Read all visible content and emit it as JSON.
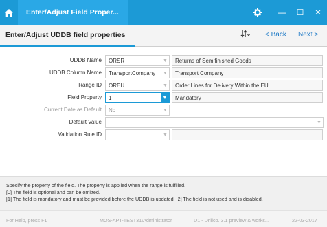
{
  "window": {
    "title": "Enter/Adjust Field Proper...",
    "home_icon": "home-icon",
    "settings_icon": "gear-icon",
    "controls": {
      "minimize": "—",
      "maximize": "☐",
      "close": "✕"
    }
  },
  "header": {
    "title": "Enter/Adjust UDDB field properties",
    "sort_icon": "sort-icon",
    "back_label": "< Back",
    "next_label": "Next >"
  },
  "form": {
    "uddb_name": {
      "label": "UDDB Name",
      "value": "ORSR",
      "description": "Returns of Semifinished Goods"
    },
    "uddb_column_name": {
      "label": "UDDB Column Name",
      "value": "TransportCompany",
      "description": "Transport Company"
    },
    "range_id": {
      "label": "Range ID",
      "value": "OREU",
      "description": "Order Lines for Delivery Within the EU"
    },
    "field_property": {
      "label": "Field Property",
      "value": "1",
      "description": "Mandatory"
    },
    "current_date_default": {
      "label": "Current Date as Default",
      "value": "No"
    },
    "default_value": {
      "label": "Default Value",
      "value": ""
    },
    "validation_rule_id": {
      "label": "Validation Rule ID",
      "value": "",
      "description": ""
    }
  },
  "help": {
    "line1": "Specify the property of the field. The property is applied when the range is fulfilled.",
    "line2": "[0] The field is optional and can be omitted.",
    "line3": "[1] The field is mandatory and must be provided before the UDDB is updated. [2] The field is not used and is disabled."
  },
  "status": {
    "help_hint": "For Help, press F1",
    "user": "MOS-APT-TEST31\\Administrator",
    "company": "D1 - Drillco. 3.1 preview & works...",
    "date": "22-03-2017"
  }
}
